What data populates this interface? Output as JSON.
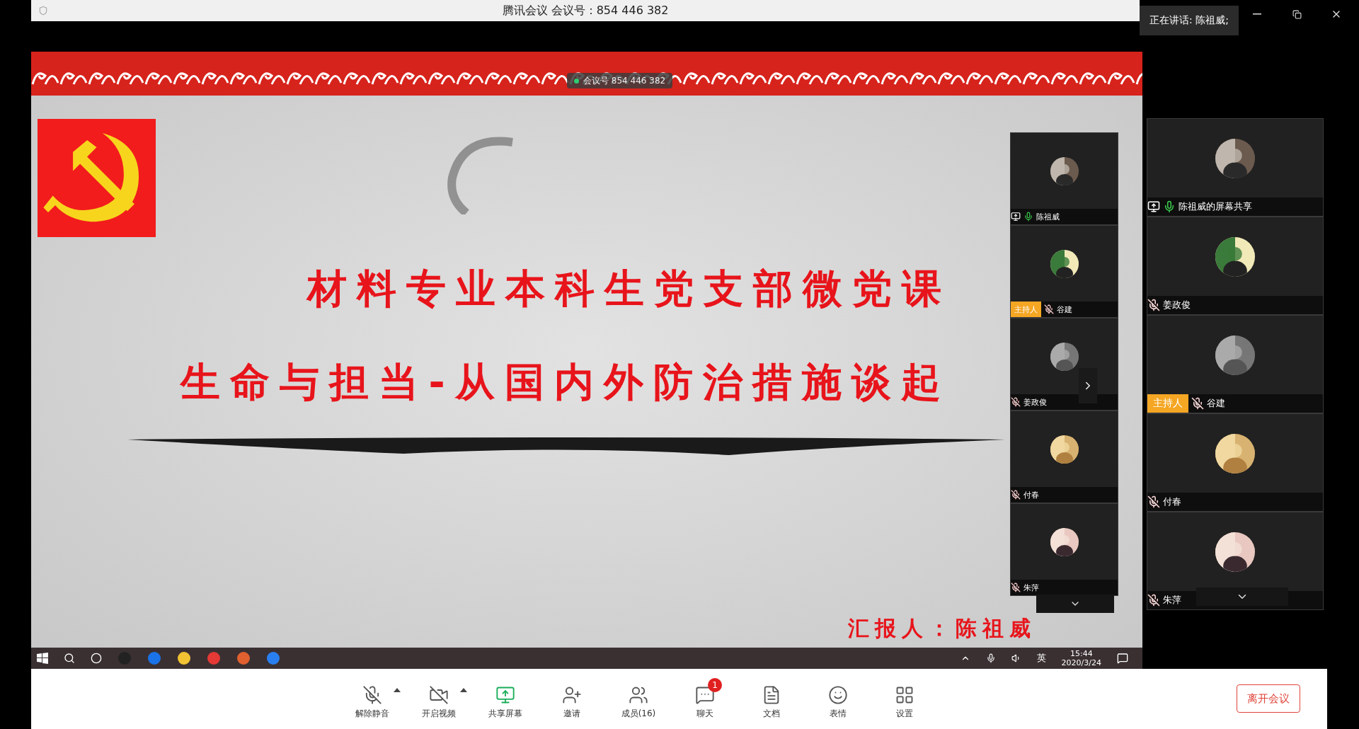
{
  "window": {
    "title": "腾讯会议 会议号：854 446 382"
  },
  "speaking_tooltip": "正在讲话: 陈祖威;",
  "meeting_badge": "会议号 854 446 382",
  "slide": {
    "title_lines": [
      "材料专业本科生党支部微党课",
      "生命与担当-从国内外防治措施谈起"
    ],
    "presenter": "汇报人：陈祖威"
  },
  "taskbar": {
    "input_indicator": "英",
    "time": "15:44",
    "date": "2020/3/24"
  },
  "video_strip": [
    {
      "name": "陈祖威",
      "host": false,
      "muted": false,
      "sharing": true
    },
    {
      "name": "谷建",
      "host": true,
      "host_label": "主持人",
      "muted": true,
      "sharing": false
    },
    {
      "name": "姜政俊",
      "host": false,
      "muted": true,
      "sharing": false
    },
    {
      "name": "付春",
      "host": false,
      "muted": true,
      "sharing": false
    },
    {
      "name": "朱萍",
      "host": false,
      "muted": true,
      "sharing": false
    }
  ],
  "video_gallery": [
    {
      "name": "陈祖威的屏幕共享",
      "host": false,
      "muted": false,
      "sharing": true
    },
    {
      "name": "姜政俊",
      "host": false,
      "muted": true,
      "sharing": false
    },
    {
      "name": "谷建",
      "host": true,
      "host_label": "主持人",
      "muted": true,
      "sharing": false
    },
    {
      "name": "付春",
      "host": false,
      "muted": true,
      "sharing": false
    },
    {
      "name": "朱萍",
      "host": false,
      "muted": true,
      "sharing": false
    }
  ],
  "toolbar": {
    "buttons": [
      {
        "kind": "mic",
        "label": "解除静音",
        "menu": true
      },
      {
        "kind": "video",
        "label": "开启视频",
        "menu": true
      },
      {
        "kind": "share",
        "label": "共享屏幕",
        "menu": false
      },
      {
        "kind": "invite",
        "label": "邀请",
        "menu": false
      },
      {
        "kind": "members",
        "label": "成员(16)",
        "menu": false
      },
      {
        "kind": "chat",
        "label": "聊天",
        "menu": false,
        "badge": "1"
      },
      {
        "kind": "docs",
        "label": "文档",
        "menu": false
      },
      {
        "kind": "emoji",
        "label": "表情",
        "menu": false
      },
      {
        "kind": "settings",
        "label": "设置",
        "menu": false
      }
    ],
    "leave": "离开会议"
  }
}
